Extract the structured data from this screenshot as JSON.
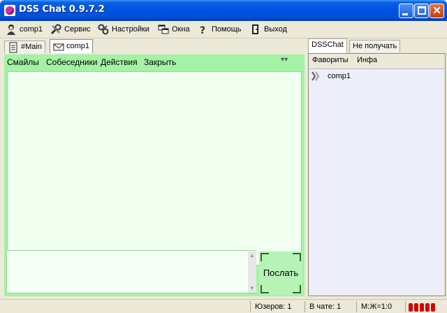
{
  "window": {
    "title": "DSS Chat 0.9.7.2"
  },
  "menubar": {
    "items": [
      {
        "label": "comp1",
        "icon": "user-icon"
      },
      {
        "label": "Сервис",
        "icon": "tools-icon"
      },
      {
        "label": "Настройки",
        "icon": "settings-icon"
      },
      {
        "label": "Окна",
        "icon": "windows-icon"
      },
      {
        "label": "Помощь",
        "icon": "help-icon"
      },
      {
        "label": "Выход",
        "icon": "exit-icon"
      }
    ]
  },
  "main_tabs": [
    {
      "label": "#Main",
      "icon": "notepad-icon"
    },
    {
      "label": "comp1",
      "icon": "envelope-icon"
    }
  ],
  "chat_menu": {
    "items": [
      "Смайлы",
      "Собеседники",
      "Действия",
      "Закрыть"
    ],
    "collapse_glyph": "▾▾"
  },
  "chat": {
    "messages": [],
    "input_value": ""
  },
  "send_button": {
    "label": "Послать"
  },
  "right_tabs": [
    "DSSChat",
    "Не получать"
  ],
  "right_menu": {
    "items": [
      "Фавориты",
      "Инфа"
    ]
  },
  "users": [
    {
      "name": "comp1"
    }
  ],
  "statusbar": {
    "users": "Юзеров: 1",
    "in_chat": "В чате: 1",
    "ratio": "М:Ж=1:0"
  },
  "colors": {
    "chat_accent": "#a4f2a4",
    "titlebar": "#0154e3",
    "indicator": "#d40000"
  }
}
